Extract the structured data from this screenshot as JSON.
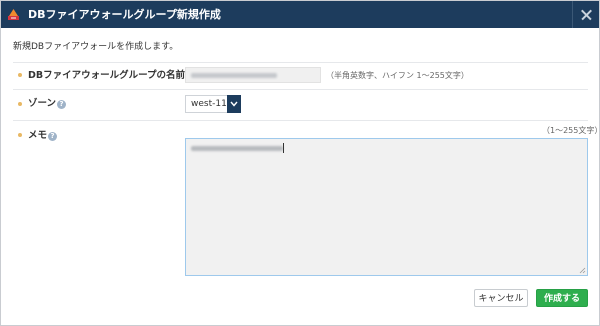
{
  "window": {
    "title": "DBファイアウォールグループ新規作成",
    "close_icon": "close-icon",
    "logo_icon": "cloud-logo-icon"
  },
  "intro_text": "新規DBファイアウォールを作成します。",
  "form": {
    "name": {
      "label": "DBファイアウォールグループの名前",
      "help": "?",
      "value_obscured": true,
      "hint": "（半角英数字、ハイフン 1〜255文字）"
    },
    "zone": {
      "label": "ゾーン",
      "help": "?",
      "selected": "west-11"
    },
    "memo": {
      "label": "メモ",
      "help": "?",
      "hint": "（1〜255文字）",
      "value_obscured": true
    }
  },
  "buttons": {
    "cancel": "キャンセル",
    "create": "作成する"
  },
  "colors": {
    "titlebar": "#1d3c5d",
    "bullet": "#e8b864",
    "primary_button": "#2eae4e",
    "focus_border": "#9ec9ec"
  }
}
